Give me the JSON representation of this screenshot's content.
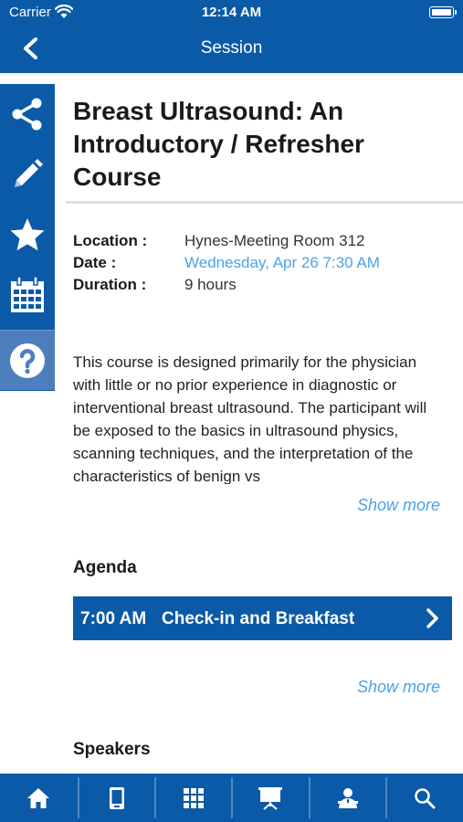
{
  "status_bar": {
    "carrier": "Carrier",
    "time": "12:14 AM"
  },
  "nav": {
    "title": "Session"
  },
  "session": {
    "title": "Breast Ultrasound: An Introductory / Refresher Course",
    "location_label": "Location :",
    "location_value": "Hynes-Meeting Room 312",
    "date_label": "Date :",
    "date_value": "Wednesday, Apr 26 7:30 AM",
    "duration_label": "Duration :",
    "duration_value": "9 hours",
    "description": "This course is designed primarily for the physician with little or no prior experience in diagnostic or interventional breast ultrasound. The participant will be exposed to the basics in ultrasound physics, scanning techniques, and the interpretation of the characteristics of benign vs",
    "show_more_label": "Show more"
  },
  "agenda": {
    "heading": "Agenda",
    "items": [
      {
        "time": "7:00 AM",
        "title": "Check-in and Breakfast"
      }
    ],
    "show_more_label": "Show more"
  },
  "speakers": {
    "heading": "Speakers"
  },
  "side_actions": [
    "share-icon",
    "pencil-icon",
    "star-icon",
    "calendar-icon",
    "help-icon"
  ],
  "tab_bar": [
    "home-icon",
    "mobile-device-icon",
    "grid-icon",
    "presentation-icon",
    "speaker-icon",
    "search-icon"
  ],
  "colors": {
    "primary": "#0a5aa8",
    "link": "#4aa3ea",
    "help_bg": "#4d7fbe"
  }
}
